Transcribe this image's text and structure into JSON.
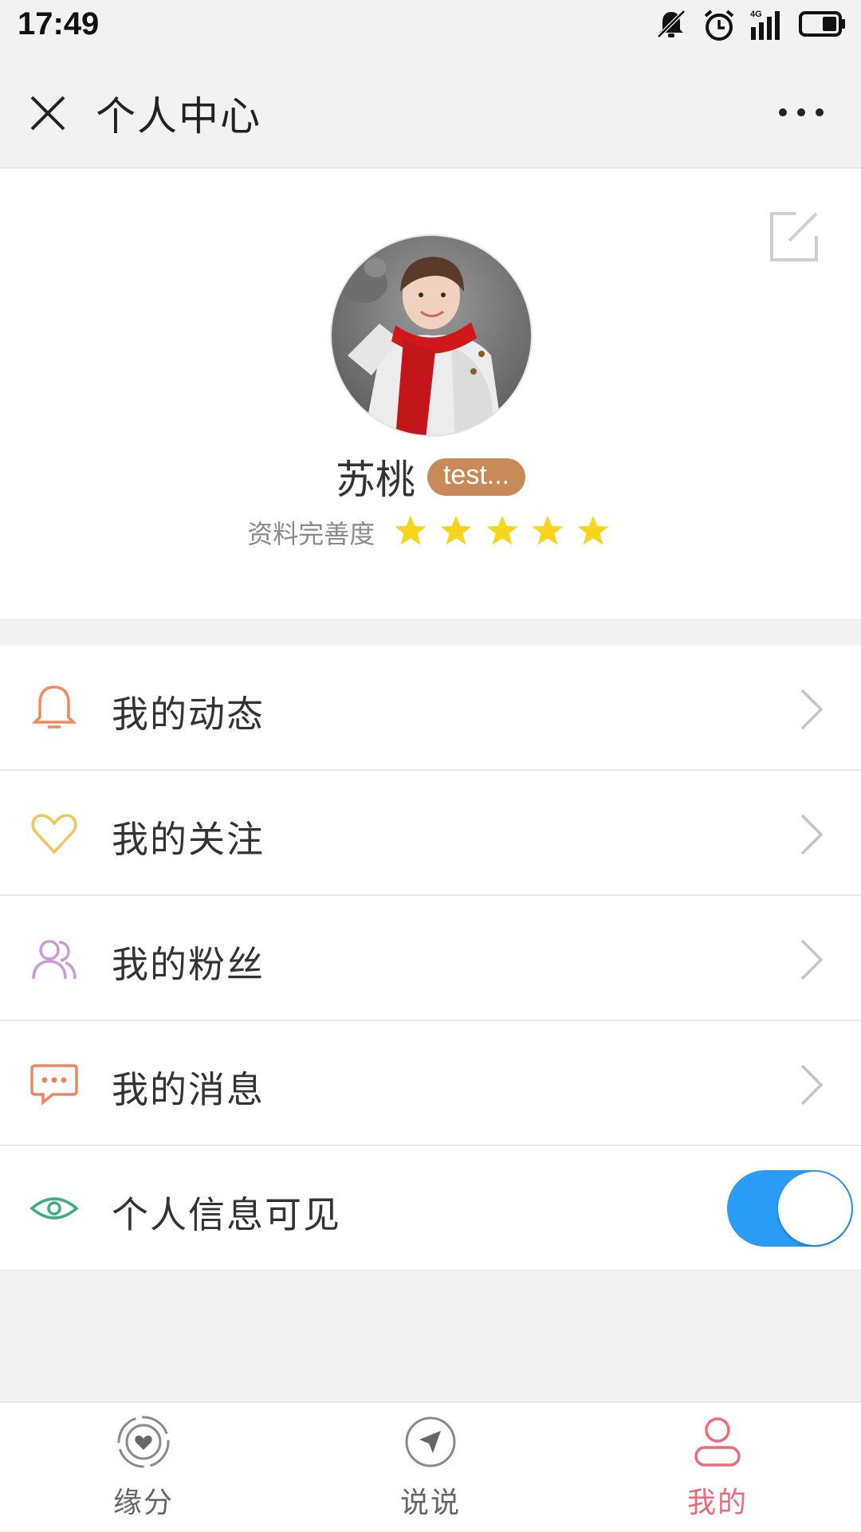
{
  "status_bar": {
    "time": "17:49",
    "icons": [
      "bell-muted-icon",
      "alarm-icon",
      "signal-4g-icon",
      "battery-icon"
    ]
  },
  "header": {
    "title": "个人中心",
    "close_icon": "close-icon",
    "more_icon": "more-icon"
  },
  "profile": {
    "name": "苏桃",
    "tag": "test...",
    "completeness_label": "资料完善度",
    "rating": 5,
    "rating_max": 5,
    "edit_icon": "edit-icon",
    "star_color": "#f7d51f"
  },
  "menu": {
    "items": [
      {
        "label": "我的动态",
        "icon": "bell-icon",
        "color": "#f08a5d"
      },
      {
        "label": "我的关注",
        "icon": "heart-icon",
        "color": "#f3c45b"
      },
      {
        "label": "我的粉丝",
        "icon": "users-icon",
        "color": "#c99ad8"
      },
      {
        "label": "我的消息",
        "icon": "message-icon",
        "color": "#f0865f"
      }
    ],
    "visibility": {
      "label": "个人信息可见",
      "icon": "eye-icon",
      "color": "#3dae7c",
      "enabled": true,
      "toggle_color": "#2b9cf5"
    }
  },
  "bottom_nav": {
    "items": [
      {
        "label": "缘分",
        "icon": "heart-target-icon"
      },
      {
        "label": "说说",
        "icon": "compass-icon"
      },
      {
        "label": "我的",
        "icon": "user-icon"
      }
    ],
    "active_index": 2,
    "active_color": "#ee6b78"
  }
}
